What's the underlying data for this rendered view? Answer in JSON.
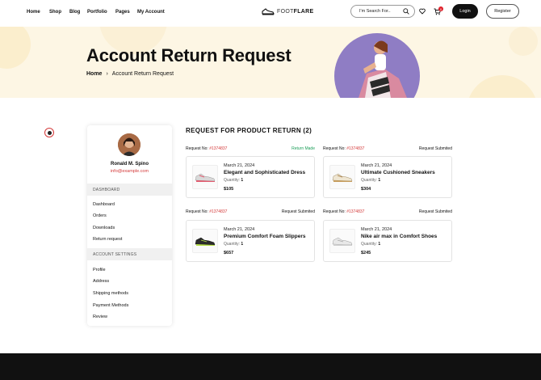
{
  "nav": {
    "items": [
      "Home",
      "Shop",
      "Blog",
      "Portfolio",
      "Pages",
      "My Account"
    ],
    "logo_left": "FOOT",
    "logo_right": "FLARE",
    "search_placeholder": "I'm Search For..",
    "cart_count": "0",
    "login_label": "Login",
    "register_label": "Register"
  },
  "hero": {
    "title": "Account Return Request",
    "breadcrumb_home": "Home",
    "breadcrumb_sep": "›",
    "breadcrumb_current": "Account Return Request"
  },
  "sidebar": {
    "name": "Ronald M. Spino",
    "email": "info@example.com",
    "dashboard_header": "DASHBOARD",
    "dashboard_items": [
      "Dashboard",
      "Orders",
      "Downloads",
      "Return request"
    ],
    "settings_header": "ACCOUNT SETTINGS",
    "settings_items": [
      "Profile",
      "Address",
      "Shipping methods",
      "Payment Methods",
      "Review"
    ]
  },
  "main": {
    "title": "REQUEST FOR PRODUCT RETURN (2)",
    "request_label": "Request No:",
    "quantity_label": "Quantity:",
    "requests": [
      {
        "no": "#1374837",
        "status": "Return Made",
        "date": "March 21, 2024",
        "name": "Elegant and Sophisticated Dress",
        "qty": "1",
        "price": "$105"
      },
      {
        "no": "#1374837",
        "status": "Request Submited",
        "date": "March 21, 2024",
        "name": "Ultimate Cushioned Sneakers",
        "qty": "1",
        "price": "$304"
      },
      {
        "no": "#1374837",
        "status": "Request Submited",
        "date": "March 21, 2024",
        "name": "Premium Comfort Foam Slippers",
        "qty": "1",
        "price": "$657"
      },
      {
        "no": "#1374837",
        "status": "Request Submited",
        "date": "March 21, 2024",
        "name": "Nike air max in Comfort Shoes",
        "qty": "1",
        "price": "$245"
      }
    ]
  },
  "colors": {
    "accent_red": "#d43a3a",
    "status_green": "#1b9e58",
    "hero_bg": "#fdf6e4",
    "hero_circle": "#8f7dc4"
  }
}
